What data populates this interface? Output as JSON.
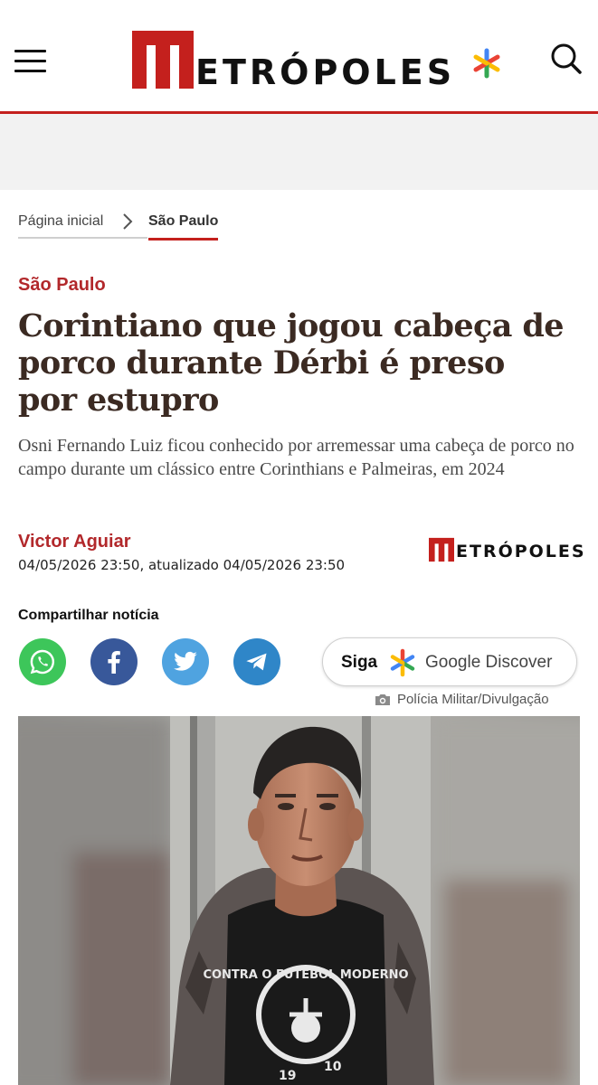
{
  "header": {
    "logo_text": "ETRÓPOLES",
    "menu_icon": "hamburger-menu-icon",
    "search_icon": "search-icon",
    "brand_color": "#c4201d"
  },
  "breadcrumb": {
    "home": "Página inicial",
    "current": "São Paulo"
  },
  "article": {
    "section": "São Paulo",
    "headline": "Corintiano que jogou cabeça de porco durante Dérbi é preso por estupro",
    "subtitle": "Osni Fernando Luiz ficou conhecido por arremessar uma cabeça de porco no campo durante um clássico entre Corinthians e Palmeiras, em 2024",
    "author": "Victor Aguiar",
    "dates": "04/05/2026 23:50, atualizado 04/05/2026 23:50",
    "small_logo_text": "ETRÓPOLES",
    "accent_color": "#b2282b"
  },
  "share": {
    "label": "Compartilhar notícia",
    "buttons": [
      {
        "name": "whatsapp",
        "icon": "whatsapp-icon",
        "color": "#3dc65a"
      },
      {
        "name": "facebook",
        "icon": "facebook-icon",
        "color": "#38589a"
      },
      {
        "name": "twitter",
        "icon": "twitter-bird-icon",
        "color": "#4fa3e0"
      },
      {
        "name": "telegram",
        "icon": "telegram-icon",
        "color": "#2f86c8"
      }
    ],
    "discover": {
      "siga": "Siga",
      "label": "Google Discover"
    }
  },
  "photo": {
    "credit": "Polícia Militar/Divulgação",
    "shirt_text": "CONTRA O FUTEBOL MODERNO",
    "shirt_numbers": [
      "19",
      "10"
    ]
  }
}
